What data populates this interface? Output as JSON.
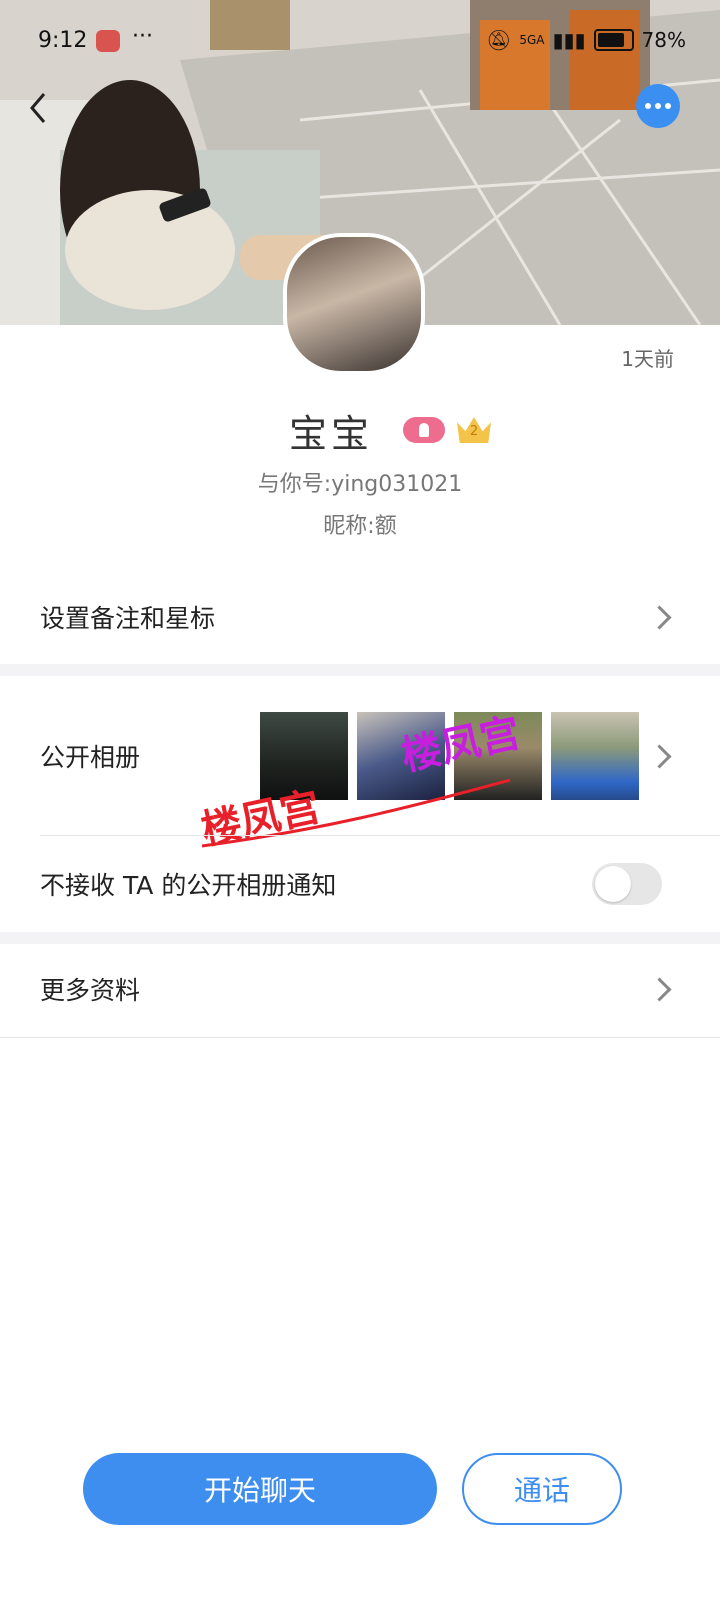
{
  "status_bar": {
    "time": "9:12",
    "signal_text": "5GA",
    "battery": "78%"
  },
  "profile": {
    "time_ago": "1天前",
    "name": "宝宝",
    "level": "2",
    "account": "与你号:ying031021",
    "nickname": "昵称:额"
  },
  "menu": {
    "remark": "设置备注和星标",
    "album": "公开相册",
    "notify": "不接收 TA 的公开相册通知",
    "notify_enabled": false,
    "more_info": "更多资料"
  },
  "watermarks": [
    "楼凤宫",
    "楼凤宫"
  ],
  "actions": {
    "chat": "开始聊天",
    "call": "通话"
  },
  "colors": {
    "accent": "#3e8ef0",
    "watermark_red": "#e8202a",
    "watermark_purple": "#c81ee0"
  }
}
